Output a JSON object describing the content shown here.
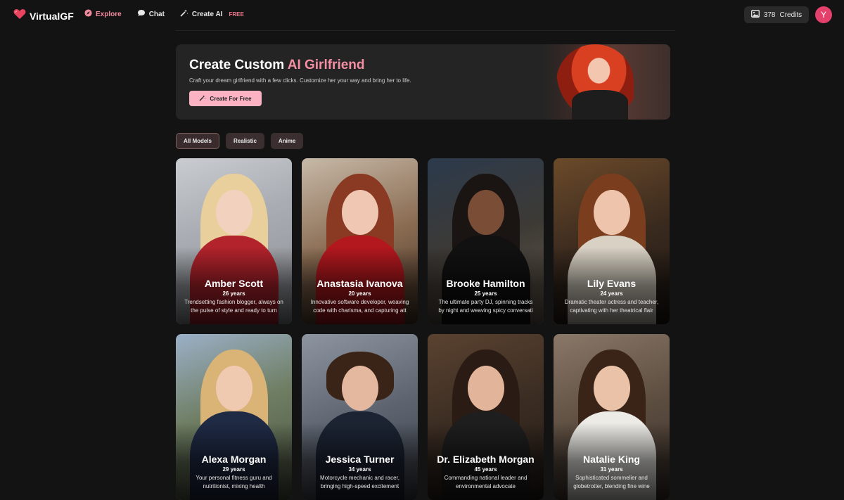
{
  "brand": {
    "name": "VirtualGF",
    "logo_icon": "heart-icon"
  },
  "nav": [
    {
      "label": "Explore",
      "icon": "compass-icon",
      "active": true
    },
    {
      "label": "Chat",
      "icon": "chat-bubble-icon",
      "active": false
    },
    {
      "label": "Create AI",
      "icon": "magic-wand-icon",
      "active": false,
      "badge": "FREE"
    }
  ],
  "credits": {
    "count": "378",
    "label": "Credits",
    "icon": "image-icon"
  },
  "user": {
    "initial": "Y"
  },
  "hero": {
    "title_plain": "Create Custom ",
    "title_accent": "AI Girlfriend",
    "description": "Craft your dream girlfriend with a few clicks. Customize her your way and bring her to life.",
    "button_label": "Create For Free",
    "button_icon": "magic-wand-icon"
  },
  "filters": [
    {
      "label": "All Models",
      "active": true
    },
    {
      "label": "Realistic",
      "active": false
    },
    {
      "label": "Anime",
      "active": false
    }
  ],
  "models": [
    {
      "name": "Amber Scott",
      "age": "26 years",
      "desc": "Trendsetting fashion blogger, always on the pulse of style and ready to turn"
    },
    {
      "name": "Anastasia Ivanova",
      "age": "20 years",
      "desc": "Innovative software developer, weaving code with charisma, and capturing att"
    },
    {
      "name": "Brooke Hamilton",
      "age": "25 years",
      "desc": "The ultimate party DJ, spinning tracks by night and weaving spicy conversati"
    },
    {
      "name": "Lily Evans",
      "age": "24 years",
      "desc": "Dramatic theater actress and teacher, captivating with her theatrical flair"
    },
    {
      "name": "Alexa Morgan",
      "age": "29 years",
      "desc": "Your personal fitness guru and nutritionist, mixing health"
    },
    {
      "name": "Jessica Turner",
      "age": "34 years",
      "desc": "Motorcycle mechanic and racer, bringing high-speed excitement"
    },
    {
      "name": "Dr. Elizabeth Morgan",
      "age": "45 years",
      "desc": "Commanding national leader and environmental advocate"
    },
    {
      "name": "Natalie King",
      "age": "31 years",
      "desc": "Sophisticated sommelier and globetrotter, blending fine wine"
    }
  ],
  "colors": {
    "accent": "#f58ea2",
    "button": "#fbb3c4",
    "avatar": "#e4406c",
    "background": "#131313"
  }
}
